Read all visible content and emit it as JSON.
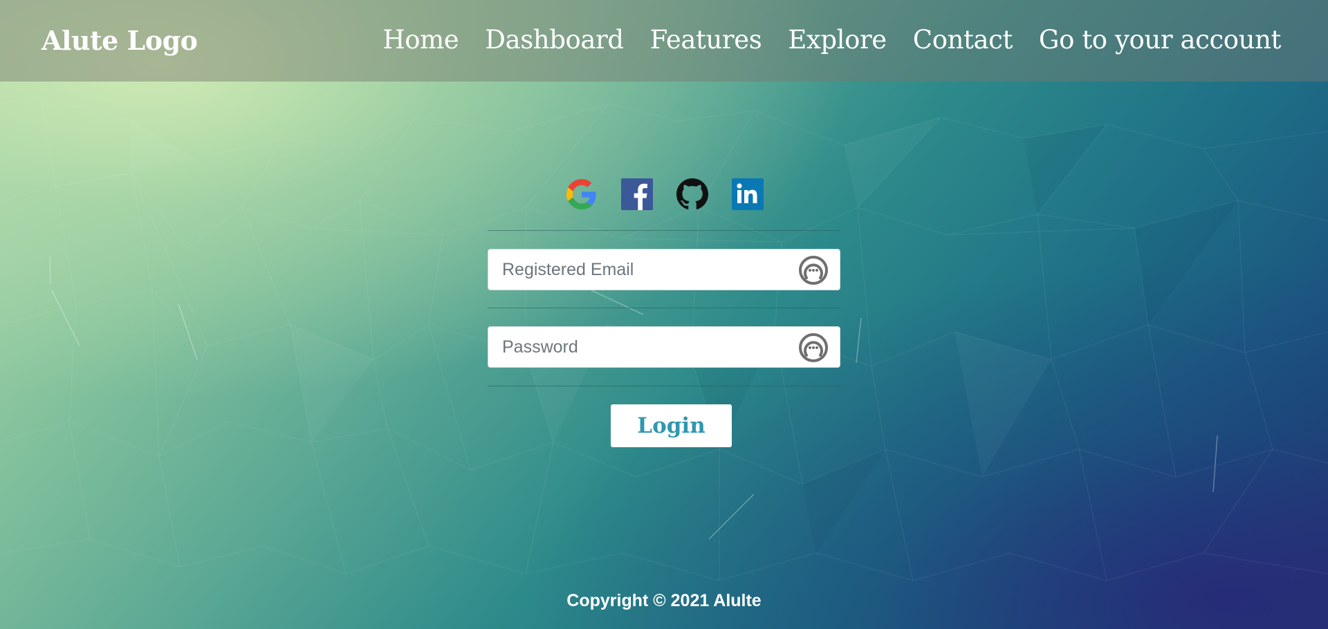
{
  "header": {
    "logo": "Alute Logo",
    "nav": [
      {
        "label": "Home"
      },
      {
        "label": "Dashboard"
      },
      {
        "label": "Features"
      },
      {
        "label": "Explore"
      },
      {
        "label": "Contact"
      },
      {
        "label": "Go to your account"
      }
    ]
  },
  "social": [
    {
      "icon": "google-icon",
      "color": "#4285F4"
    },
    {
      "icon": "facebook-icon",
      "color": "#3B5998"
    },
    {
      "icon": "github-icon",
      "color": "#111111"
    },
    {
      "icon": "linkedin-icon",
      "color": "#0A78B5"
    }
  ],
  "form": {
    "email": {
      "value": "",
      "placeholder": "Registered Email",
      "icon": "password-manager-icon"
    },
    "password": {
      "value": "",
      "placeholder": "Password",
      "icon": "password-manager-icon"
    },
    "login_label": "Login"
  },
  "footer": {
    "copyright": "Copyright © 2021 Alulte"
  },
  "colors": {
    "login_text": "#2F97B0",
    "navbar_overlay": "rgba(120,120,110,0.45)"
  }
}
